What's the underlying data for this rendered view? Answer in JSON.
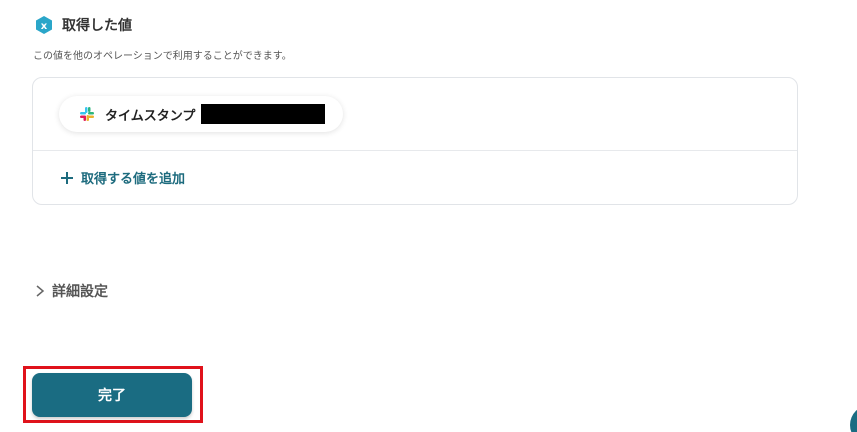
{
  "section": {
    "title": "取得した値",
    "description": "この値を他のオペレーションで利用することができます。",
    "icon": "variable-x-icon"
  },
  "values": {
    "items": [
      {
        "label": "タイムスタンプ",
        "icon": "slack-icon"
      }
    ],
    "add_label": "取得する値を追加"
  },
  "details": {
    "label": "詳細設定"
  },
  "footer": {
    "done_label": "完了"
  },
  "colors": {
    "accent": "#1a6c82",
    "link": "#1d6b7e",
    "highlight": "#e0121b"
  }
}
